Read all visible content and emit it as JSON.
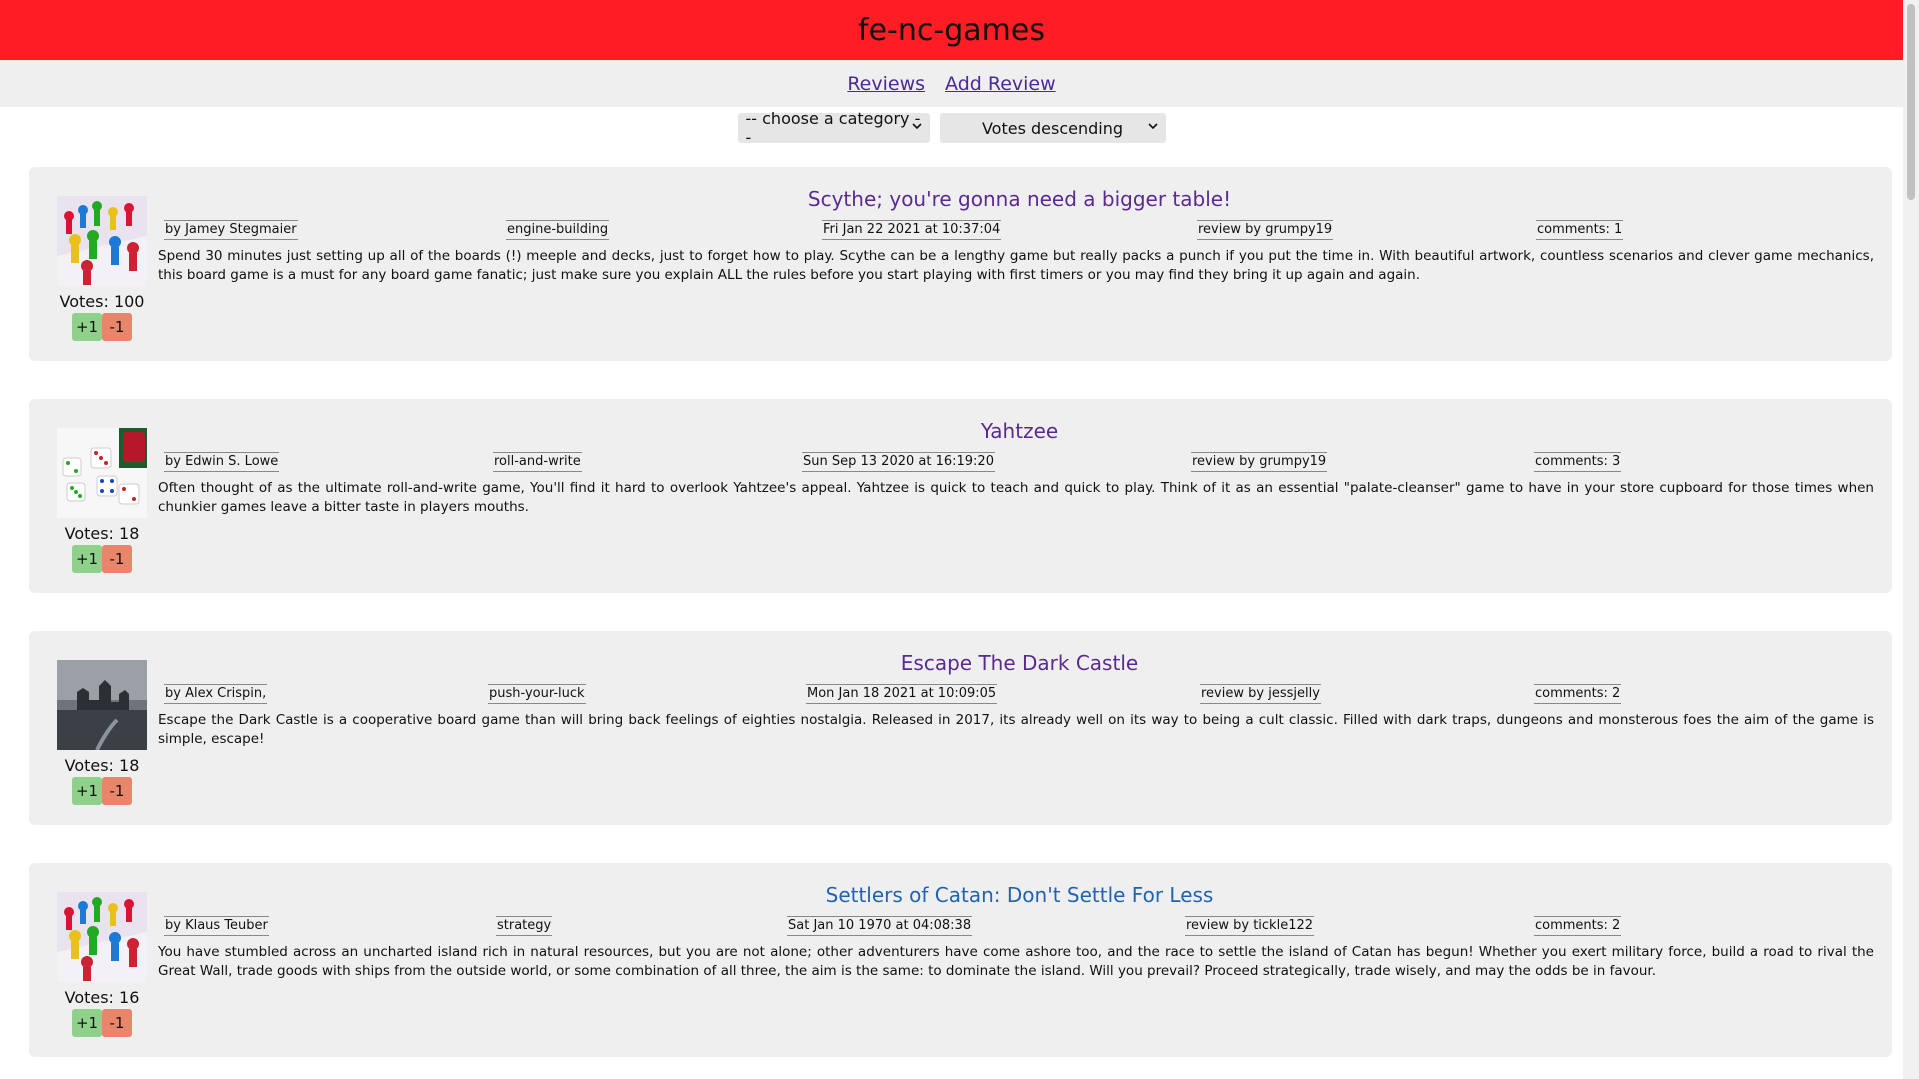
{
  "app": {
    "title": "fe-nc-games"
  },
  "nav": {
    "reviews": "Reviews",
    "add_review": "Add Review"
  },
  "filters": {
    "category": "-- choose a category --",
    "sort": "Votes descending"
  },
  "colors": {
    "header": "#ff1d25",
    "title_purple": "#5b2a91",
    "title_blue": "#1f63b3",
    "upvote": "#8fd08a",
    "downvote": "#e8856a"
  },
  "reviews": [
    {
      "title": "Scythe; you're gonna need a bigger table!",
      "designer": "by Jamey Stegmaier",
      "category": "engine-building",
      "date": "Fri Jan 22 2021 at 10:37:04",
      "author": "review by grumpy19",
      "comments": "comments: 1",
      "body": "Spend 30 minutes just setting up all of the boards (!) meeple and decks, just to forget how to play. Scythe can be a lengthy game but really packs a punch if you put the time in. With beautiful artwork, countless scenarios and clever game mechanics, this board game is a must for any board game fanatic; just make sure you explain ALL the rules before you start playing with first timers or you may find they bring it up again and again.",
      "votes": "Votes: 100",
      "upvote": "+1",
      "downvote": "-1",
      "image": "board-pieces"
    },
    {
      "title": "Yahtzee",
      "designer": "by Edwin S. Lowe",
      "category": "roll-and-write",
      "date": "Sun Sep 13 2020 at 16:19:20",
      "author": "review by grumpy19",
      "comments": "comments: 3",
      "body": "Often thought of as the ultimate roll-and-write game, You'll find it hard to overlook Yahtzee's appeal. Yahtzee is quick to teach and quick to play. Think of it as an essential \"palate-cleanser\" game to have in your store cupboard for those times when chunkier games leave a bitter taste in players mouths.",
      "votes": "Votes: 18",
      "upvote": "+1",
      "downvote": "-1",
      "image": "dice"
    },
    {
      "title": "Escape The Dark Castle",
      "designer": "by Alex Crispin,",
      "category": "push-your-luck",
      "date": "Mon Jan 18 2021 at 10:09:05",
      "author": "review by jessjelly",
      "comments": "comments: 2",
      "body": "Escape the Dark Castle is a cooperative board game than will bring back feelings of eighties nostalgia. Released in 2017, its already well on its way to being a cult classic. Filled with dark traps, dungeons and monsterous foes the aim of the game is simple, escape!",
      "votes": "Votes: 18",
      "upvote": "+1",
      "downvote": "-1",
      "image": "castle"
    },
    {
      "title": "Settlers of Catan: Don't Settle For Less",
      "designer": "by Klaus Teuber",
      "category": "strategy",
      "date": "Sat Jan 10 1970 at 04:08:38",
      "author": "review by tickle122",
      "comments": "comments: 2",
      "body": "You have stumbled across an uncharted island rich in natural resources, but you are not alone; other adventurers have come ashore too, and the race to settle the island of Catan has begun! Whether you exert military force, build a road to rival the Great Wall, trade goods with ships from the outside world, or some combination of all three, the aim is the same: to dominate the island. Will you prevail? Proceed strategically, trade wisely, and may the odds be in favour.",
      "votes": "Votes: 16",
      "upvote": "+1",
      "downvote": "-1",
      "image": "board-pieces"
    }
  ]
}
